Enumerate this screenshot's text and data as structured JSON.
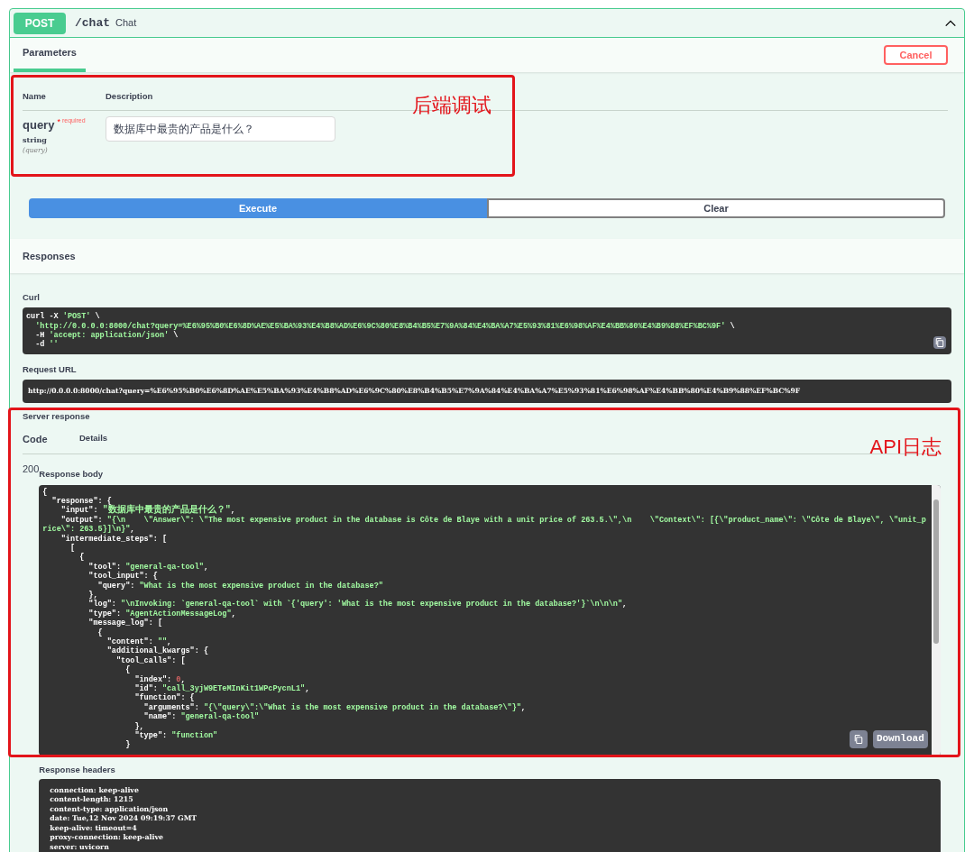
{
  "operation": {
    "method": "POST",
    "path": "/chat",
    "summary": "Chat",
    "expanded": true
  },
  "parameters_tab": {
    "label": "Parameters",
    "selected": true
  },
  "cancel_button": "Cancel",
  "parameters_table": {
    "columns": [
      "Name",
      "Description"
    ],
    "rows": [
      {
        "name": "query",
        "required_mark": "*",
        "required_label": "required",
        "type": "string",
        "location": "(query)",
        "value": "数据库中最贵的产品是什么？"
      }
    ]
  },
  "buttons": [
    {
      "label": "Execute",
      "kind": "primary"
    },
    {
      "label": "Clear",
      "kind": "secondary"
    }
  ],
  "responses_title": "Responses",
  "curl": {
    "label": "Curl",
    "lines": [
      [
        {
          "kind": "plain",
          "text": "curl -X "
        },
        {
          "kind": "string",
          "text": "'POST'"
        },
        {
          "kind": "plain",
          "text": " \\"
        }
      ],
      [
        {
          "kind": "string",
          "text": "  'http://0.0.0.0:8000/chat?query=%E6%95%B0%E6%8D%AE%E5%BA%93%E4%B8%AD%E6%9C%80%E8%B4%B5%E7%9A%84%E4%BA%A7%E5%93%81%E6%98%AF%E4%BB%80%E4%B9%88%EF%BC%9F'"
        },
        {
          "kind": "plain",
          "text": " \\"
        }
      ],
      [
        {
          "kind": "plain",
          "text": "  -H "
        },
        {
          "kind": "string",
          "text": "'accept: application/json'"
        },
        {
          "kind": "plain",
          "text": " \\"
        }
      ],
      [
        {
          "kind": "plain",
          "text": "  -d "
        },
        {
          "kind": "string",
          "text": "''"
        }
      ]
    ]
  },
  "request_url": {
    "label": "Request URL",
    "value": "http://0.0.0.0:8000/chat?query=%E6%95%B0%E6%8D%AE%E5%BA%93%E4%B8%AD%E6%9C%80%E8%B4%B5%E7%9A%84%E4%BA%A7%E5%93%81%E6%98%AF%E4%BB%80%E4%B9%88%EF%BC%9F"
  },
  "server_response": {
    "label": "Server response",
    "columns": [
      "Code",
      "Details"
    ],
    "code": "200",
    "body_label": "Response body",
    "body_lines": [
      [
        {
          "kind": "plain",
          "text": "{"
        }
      ],
      [
        {
          "kind": "plain",
          "text": "  \"response\": {"
        }
      ],
      [
        {
          "kind": "plain",
          "text": "    \"input\": "
        },
        {
          "kind": "cjk_string",
          "text": "\"数据库中最贵的产品是什么？\""
        },
        {
          "kind": "plain",
          "text": ","
        }
      ],
      [
        {
          "kind": "plain",
          "text": "    \"output\": "
        },
        {
          "kind": "string",
          "text": "\"{\\n    \\\"Answer\\\": \\\"The most expensive product in the database is Côte de Blaye with a unit price of 263.5.\\\",\\n    \\\"Context\\\": [{\\\"product_name\\\": \\\"Côte de Blaye\\\", \\\"unit_p"
        }
      ],
      [
        {
          "kind": "string",
          "text": "rice\\\": 263.5}]\\n}\""
        },
        {
          "kind": "plain",
          "text": ","
        }
      ],
      [
        {
          "kind": "plain",
          "text": "    \"intermediate_steps\": ["
        }
      ],
      [
        {
          "kind": "plain",
          "text": "      ["
        }
      ],
      [
        {
          "kind": "plain",
          "text": "        {"
        }
      ],
      [
        {
          "kind": "plain",
          "text": "          \"tool\": "
        },
        {
          "kind": "string",
          "text": "\"general-qa-tool\""
        },
        {
          "kind": "plain",
          "text": ","
        }
      ],
      [
        {
          "kind": "plain",
          "text": "          \"tool_input\": {"
        }
      ],
      [
        {
          "kind": "plain",
          "text": "            \"query\": "
        },
        {
          "kind": "string",
          "text": "\"What is the most expensive product in the database?\""
        }
      ],
      [
        {
          "kind": "plain",
          "text": "          },"
        }
      ],
      [
        {
          "kind": "plain",
          "text": "          \"log\": "
        },
        {
          "kind": "string",
          "text": "\"\\nInvoking: `general-qa-tool` with `{'query': 'What is the most expensive product in the database?'}`\\n\\n\\n\""
        },
        {
          "kind": "plain",
          "text": ","
        }
      ],
      [
        {
          "kind": "plain",
          "text": "          \"type\": "
        },
        {
          "kind": "string",
          "text": "\"AgentActionMessageLog\""
        },
        {
          "kind": "plain",
          "text": ","
        }
      ],
      [
        {
          "kind": "plain",
          "text": "          \"message_log\": ["
        }
      ],
      [
        {
          "kind": "plain",
          "text": "            {"
        }
      ],
      [
        {
          "kind": "plain",
          "text": "              \"content\": "
        },
        {
          "kind": "string",
          "text": "\"\""
        },
        {
          "kind": "plain",
          "text": ","
        }
      ],
      [
        {
          "kind": "plain",
          "text": "              \"additional_kwargs\": {"
        }
      ],
      [
        {
          "kind": "plain",
          "text": "                \"tool_calls\": ["
        }
      ],
      [
        {
          "kind": "plain",
          "text": "                  {"
        }
      ],
      [
        {
          "kind": "plain",
          "text": "                    \"index\": "
        },
        {
          "kind": "number",
          "text": "0"
        },
        {
          "kind": "plain",
          "text": ","
        }
      ],
      [
        {
          "kind": "plain",
          "text": "                    \"id\": "
        },
        {
          "kind": "string",
          "text": "\"call_3yjW9ETeMInKit1WPcPycnL1\""
        },
        {
          "kind": "plain",
          "text": ","
        }
      ],
      [
        {
          "kind": "plain",
          "text": "                    \"function\": {"
        }
      ],
      [
        {
          "kind": "plain",
          "text": "                      \"arguments\": "
        },
        {
          "kind": "string",
          "text": "\"{\\\"query\\\":\\\"What is the most expensive product in the database?\\\"}\""
        },
        {
          "kind": "plain",
          "text": ","
        }
      ],
      [
        {
          "kind": "plain",
          "text": "                      \"name\": "
        },
        {
          "kind": "string",
          "text": "\"general-qa-tool\""
        }
      ],
      [
        {
          "kind": "plain",
          "text": "                    },"
        }
      ],
      [
        {
          "kind": "plain",
          "text": "                    \"type\": "
        },
        {
          "kind": "string",
          "text": "\"function\""
        }
      ],
      [
        {
          "kind": "plain",
          "text": "                  }"
        }
      ]
    ],
    "download_button": "Download",
    "headers_label": "Response headers",
    "header_lines": [
      "connection: keep-alive",
      "content-length: 1215",
      "content-type: application/json",
      "date: Tue,12 Nov 2024 09:19:37 GMT",
      "keep-alive: timeout=4",
      "proxy-connection: keep-alive",
      "server: uvicorn"
    ]
  },
  "annotations": [
    {
      "label": "后端调试"
    },
    {
      "label": "API日志"
    }
  ]
}
